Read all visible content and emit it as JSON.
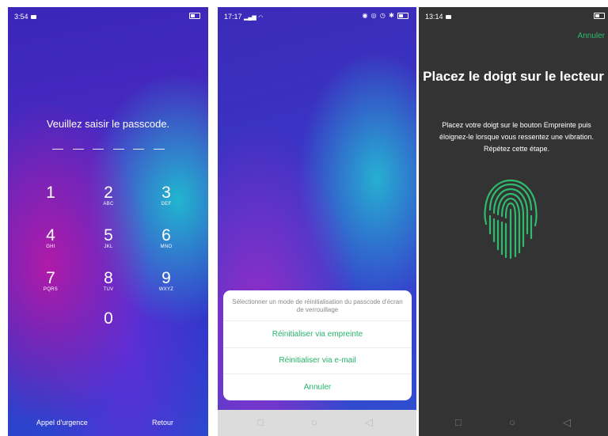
{
  "screen1": {
    "status": {
      "time": "3:54"
    },
    "prompt": "Veuillez saisir le passcode.",
    "keys": [
      {
        "digit": "1",
        "letters": ""
      },
      {
        "digit": "2",
        "letters": "ABC"
      },
      {
        "digit": "3",
        "letters": "DEF"
      },
      {
        "digit": "4",
        "letters": "GHI"
      },
      {
        "digit": "5",
        "letters": "JKL"
      },
      {
        "digit": "6",
        "letters": "MNO"
      },
      {
        "digit": "7",
        "letters": "PQRS"
      },
      {
        "digit": "8",
        "letters": "TUV"
      },
      {
        "digit": "9",
        "letters": "WXYZ"
      },
      {
        "digit": "0",
        "letters": ""
      }
    ],
    "emergency": "Appel d'urgence",
    "back": "Retour"
  },
  "screen2": {
    "status": {
      "time": "17:17"
    },
    "dialog": {
      "title": "Sélectionner un mode de réinitialisation du passcode d'écran de verrouillage",
      "option_fingerprint": "Réinitialiser via empreinte",
      "option_email": "Réinitialiser via e-mail",
      "cancel": "Annuler"
    },
    "accent": "#27b46b"
  },
  "screen3": {
    "status": {
      "time": "13:14"
    },
    "cancel": "Annuler",
    "title": "Placez le doigt sur le lecteur",
    "description": "Placez votre doigt sur le bouton Empreinte puis éloignez-le lorsque vous ressentez une vibration. Répétez cette étape.",
    "fingerprint_icon": "fingerprint-icon",
    "accent": "#2fbb6e"
  }
}
